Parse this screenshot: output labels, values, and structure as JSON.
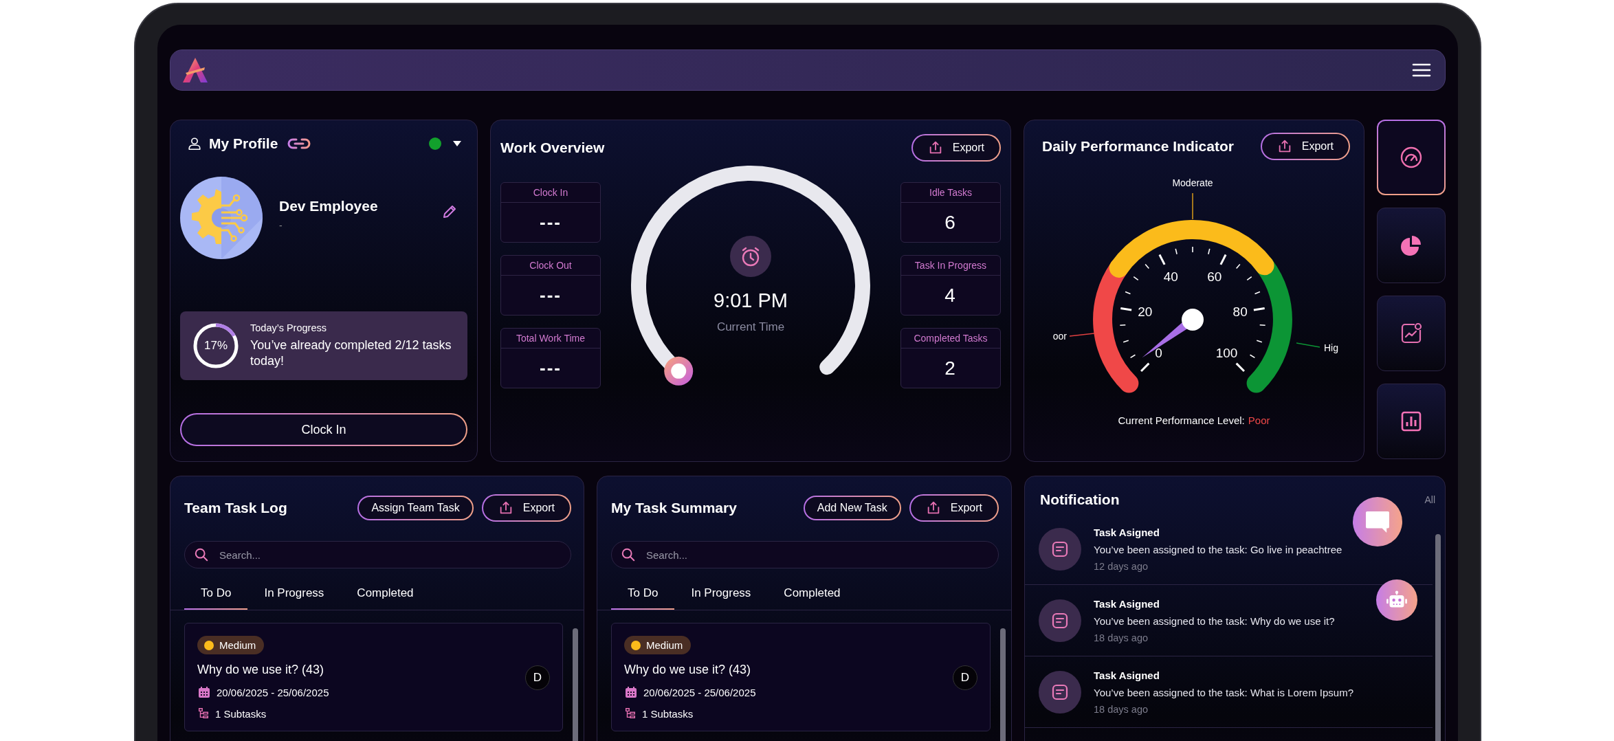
{
  "profile": {
    "title": "My Profile",
    "online": true,
    "name": "Dev Employee",
    "subtitle": "-",
    "progress": {
      "title": "Today’s Progress",
      "percent": "17%",
      "level": 0.17,
      "message": "You’ve already completed 2/12 tasks today!"
    },
    "button": "Clock In"
  },
  "work_overview": {
    "title": "Work Overview",
    "export": "Export",
    "left_stats": [
      {
        "label": "Clock In",
        "value": "---"
      },
      {
        "label": "Clock Out",
        "value": "---"
      },
      {
        "label": "Total Work Time",
        "value": "---"
      }
    ],
    "right_stats": [
      {
        "label": "Idle Tasks",
        "value": "6"
      },
      {
        "label": "Task In Progress",
        "value": "4"
      },
      {
        "label": "Completed Tasks",
        "value": "2"
      }
    ],
    "time": "9:01 PM",
    "time_label": "Current Time"
  },
  "performance": {
    "title": "Daily Performance Indicator",
    "export": "Export",
    "zone_labels": {
      "low": "oor",
      "mid": "Moderate",
      "high": "Hig"
    },
    "scale": [
      "0",
      "20",
      "40",
      "60",
      "80",
      "100"
    ],
    "status_label": "Current Performance Level:",
    "status_value": "Poor"
  },
  "side_tabs": [
    {
      "kind": "gauge",
      "selected": true
    },
    {
      "kind": "pie",
      "selected": false
    },
    {
      "kind": "trend",
      "selected": false
    },
    {
      "kind": "bars",
      "selected": false
    }
  ],
  "task_panels": [
    {
      "title": "Team Task Log",
      "action": "Assign Team Task",
      "export": "Export",
      "search": {
        "placeholder": "Search..."
      },
      "tabs": [
        {
          "label": "To Do",
          "selected": true
        },
        {
          "label": "In Progress",
          "selected": false
        },
        {
          "label": "Completed",
          "selected": false
        }
      ],
      "tasks": [
        {
          "priority": "Medium",
          "title": "Why do we use it? (43)",
          "dates": "20/06/2025 - 25/06/2025",
          "subtasks": "1 Subtasks",
          "assignee": "D"
        }
      ]
    },
    {
      "title": "My Task Summary",
      "action": "Add New Task",
      "export": "Export",
      "search": {
        "placeholder": "Search..."
      },
      "tabs": [
        {
          "label": "To Do",
          "selected": true
        },
        {
          "label": "In Progress",
          "selected": false
        },
        {
          "label": "Completed",
          "selected": false
        }
      ],
      "tasks": [
        {
          "priority": "Medium",
          "title": "Why do we use it? (43)",
          "dates": "20/06/2025 - 25/06/2025",
          "subtasks": "1 Subtasks",
          "assignee": "D"
        }
      ]
    }
  ],
  "notifications": {
    "title": "Notification",
    "link": "All",
    "items": [
      {
        "title": "Task Asigned",
        "message": "You’ve been assigned to the task: Go live in peachtree",
        "time": "12 days ago"
      },
      {
        "title": "Task Asigned",
        "message": "You’ve been assigned to the task: Why do we use it?",
        "time": "18 days ago"
      },
      {
        "title": "Task Asigned",
        "message": "You’ve been assigned to the task: What is Lorem Ipsum?",
        "time": "18 days ago"
      }
    ]
  }
}
